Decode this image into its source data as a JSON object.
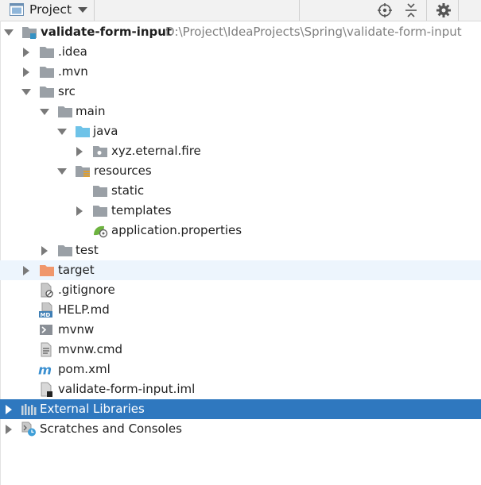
{
  "header": {
    "title": "Project",
    "icon": "project-window-icon",
    "actions": [
      "locate-icon",
      "collapse-all-icon",
      "settings-icon"
    ]
  },
  "tree": {
    "root": {
      "label": "validate-form-input",
      "path": "D:\\Project\\IdeaProjects\\Spring\\validate-form-input"
    },
    "idea": ".idea",
    "mvn": ".mvn",
    "src": "src",
    "main": "main",
    "java": "java",
    "package": "xyz.eternal.fire",
    "resources": "resources",
    "static": "static",
    "templates": "templates",
    "app_properties": "application.properties",
    "test": "test",
    "target": "target",
    "gitignore": ".gitignore",
    "help": "HELP.md",
    "mvnw": "mvnw",
    "mvnw_cmd": "mvnw.cmd",
    "pom": "pom.xml",
    "iml": "validate-form-input.iml",
    "external_libraries": "External Libraries",
    "scratches": "Scratches and Consoles"
  },
  "colors": {
    "selection": "#2f78bf",
    "hover_row": "#edf5fd",
    "folder_gray": "#9aa0a6",
    "folder_blue": "#6fc3e8",
    "folder_orange": "#f0976c",
    "path_gray": "#7f7f7f"
  }
}
